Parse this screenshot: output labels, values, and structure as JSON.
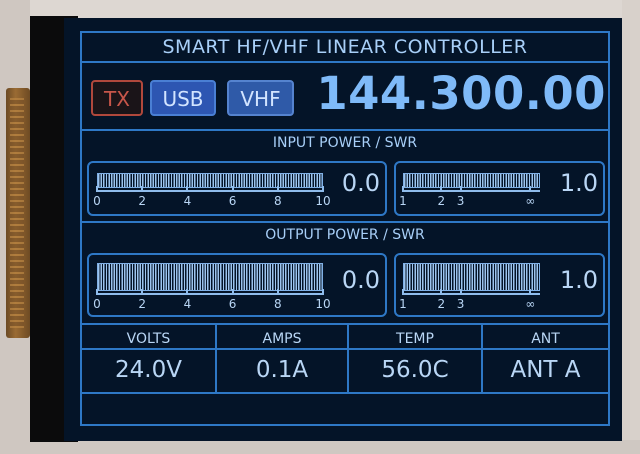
{
  "header": {
    "title": "SMART HF/VHF LINEAR CONTROLLER"
  },
  "controls": {
    "tx_label": "TX",
    "mode_label": "USB",
    "band_label": "VHF",
    "frequency": "144.300.00"
  },
  "input": {
    "section_title": "INPUT POWER / SWR",
    "power": {
      "reading": "0.0",
      "scale_labels": [
        "0",
        "2",
        "4",
        "6",
        "8",
        "10"
      ],
      "level": 0.0
    },
    "swr": {
      "reading": "1.0",
      "scale_labels": [
        "1",
        "2",
        "3",
        "∞"
      ],
      "level": 1.0
    }
  },
  "output": {
    "section_title": "OUTPUT POWER / SWR",
    "power": {
      "reading": "0.0",
      "scale_labels": [
        "0",
        "2",
        "4",
        "6",
        "8",
        "10"
      ],
      "level": 0.0
    },
    "swr": {
      "reading": "1.0",
      "scale_labels": [
        "1",
        "2",
        "3",
        "∞"
      ],
      "level": 1.0
    }
  },
  "status": {
    "columns": [
      {
        "label": "VOLTS",
        "value": "24.0V"
      },
      {
        "label": "AMPS",
        "value": "0.1A"
      },
      {
        "label": "TEMP",
        "value": "56.0C"
      },
      {
        "label": "ANT",
        "value": "ANT A"
      }
    ]
  },
  "colors": {
    "screen_background": "#041428",
    "frame": "#2e78c6",
    "text": "#a8cff8",
    "frequency": "#7fbaf8",
    "tx_red": "#c7564a",
    "button_blue": "#2d56b2"
  }
}
